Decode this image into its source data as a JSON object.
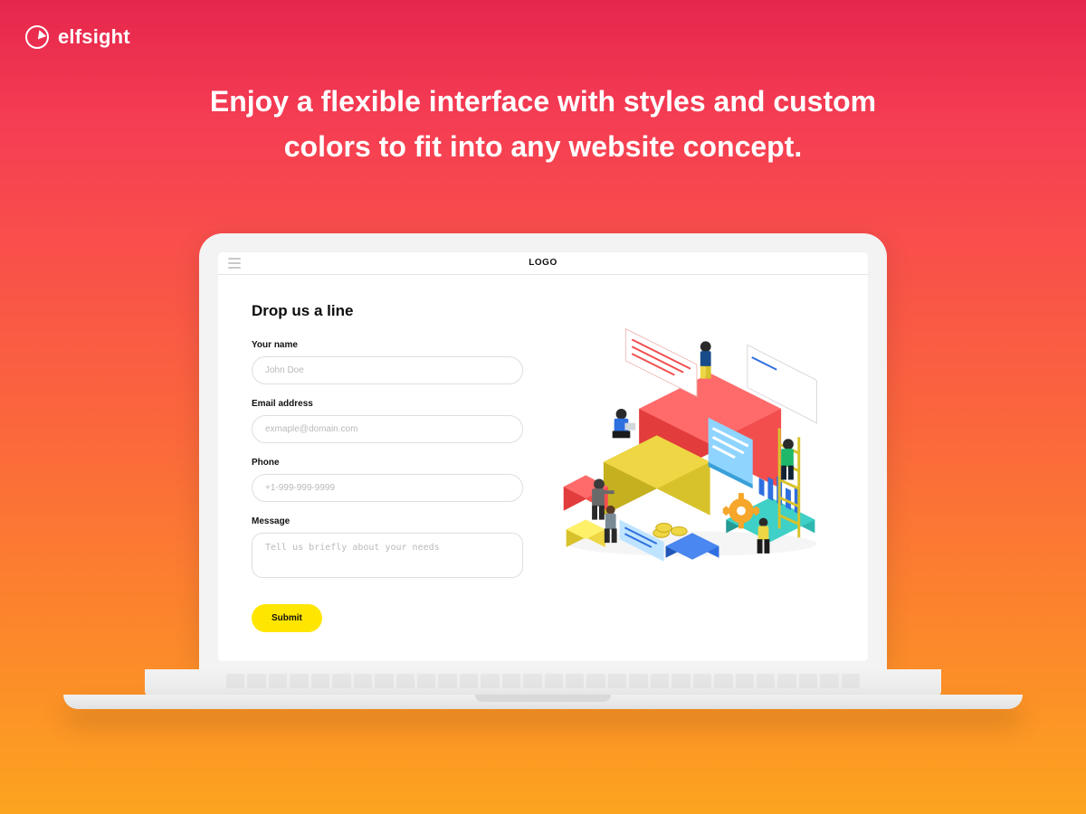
{
  "brand": {
    "name": "elfsight"
  },
  "headline": "Enjoy a flexible interface with styles and custom colors to fit into any website concept.",
  "browser": {
    "logo": "LOGO"
  },
  "form": {
    "title": "Drop us a line",
    "fields": {
      "name": {
        "label": "Your name",
        "placeholder": "John Doe"
      },
      "email": {
        "label": "Email address",
        "placeholder": "exmaple@domain.com"
      },
      "phone": {
        "label": "Phone",
        "placeholder": "+1-999-999-9999"
      },
      "message": {
        "label": "Message",
        "placeholder": "Tell us briefly about your needs"
      }
    },
    "submit": "Submit"
  },
  "colors": {
    "accent_yellow": "#ffe600",
    "block_red": "#f24e4e",
    "block_gold": "#d8c22b",
    "block_teal": "#2fb8b0",
    "gear_orange": "#f6a62a",
    "person_blue": "#2e6fe0"
  }
}
